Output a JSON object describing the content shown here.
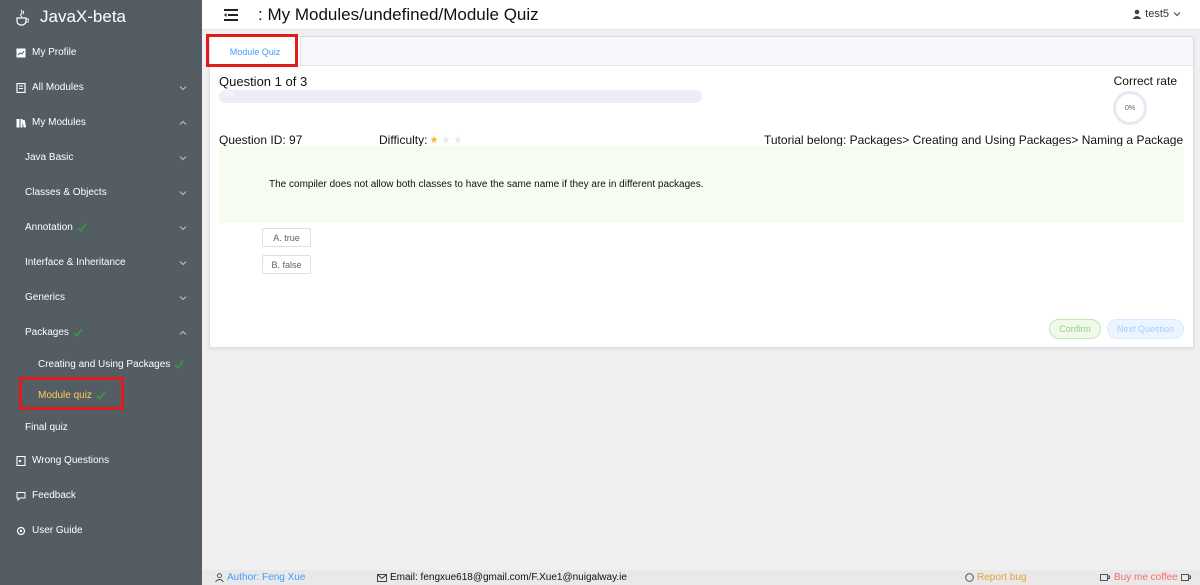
{
  "app": {
    "title": "JavaX-beta",
    "logo_icon": "java-cup-icon"
  },
  "sidebar": {
    "items": [
      {
        "label": "My Profile",
        "icon": "chart-icon"
      },
      {
        "label": "All Modules",
        "icon": "book-icon"
      },
      {
        "label": "My Modules",
        "icon": "books-icon"
      },
      {
        "label": "Java Basic"
      },
      {
        "label": "Classes & Objects"
      },
      {
        "label": "Annotation"
      },
      {
        "label": "Interface & Inheritance"
      },
      {
        "label": "Generics"
      },
      {
        "label": "Packages"
      },
      {
        "label": "Creating and Using Packages"
      },
      {
        "label": "Module quiz"
      },
      {
        "label": "Final quiz"
      },
      {
        "label": "Wrong Questions",
        "icon": "document-icon"
      },
      {
        "label": "Feedback",
        "icon": "chat-icon"
      },
      {
        "label": "User Guide",
        "icon": "settings-icon"
      }
    ]
  },
  "header": {
    "breadcrumb": ": My Modules/undefined/Module Quiz",
    "username": "test5"
  },
  "quiz": {
    "tab_label": "Module Quiz",
    "question_counter": "Question 1 of 3",
    "progress_text": "0%",
    "progress_value": 0,
    "correct_rate_label": "Correct rate",
    "correct_rate_value": "0%",
    "question_id": "Question ID: 97",
    "difficulty_label": "Difficulty:",
    "difficulty_stars": 1,
    "difficulty_max": 3,
    "tutorial_belong": "Tutorial belong:  Packages> Creating and Using Packages> Naming a Package",
    "question_text": "The compiler does not allow both classes to have the same name if they are in different packages.",
    "options": [
      "A. true",
      "B. false"
    ],
    "confirm_label": "Confirm",
    "next_label": "Next Question"
  },
  "footer": {
    "author": "Author: Feng Xue",
    "email": "Email: fengxue618@gmail.com/F.Xue1@nuigalway.ie",
    "report": "Report bug",
    "coffee": "Buy me coffee"
  },
  "colors": {
    "sidebar_bg": "#545c64",
    "active": "#ffd04b",
    "primary": "#409eff",
    "check": "#2ea043",
    "highlight": "#e01b1b"
  }
}
